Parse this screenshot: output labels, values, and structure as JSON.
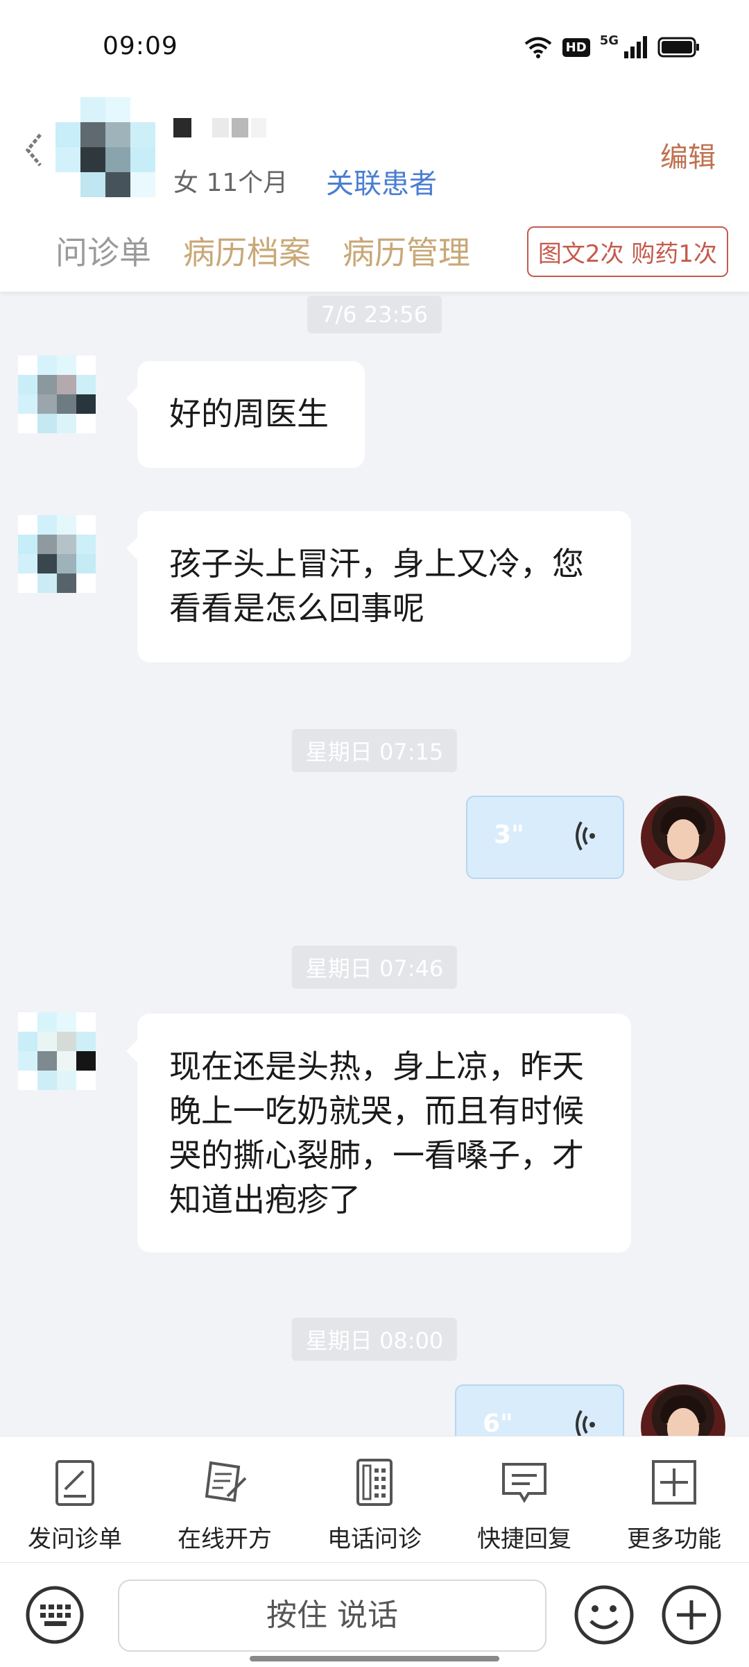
{
  "status_bar": {
    "time": "09:09",
    "hd": "HD",
    "network": "5G"
  },
  "header": {
    "patient_meta": "女 11个月",
    "link_patient_label": "关联患者",
    "edit_label": "编辑",
    "tabs": [
      {
        "label": "问诊单"
      },
      {
        "label": "病历档案"
      },
      {
        "label": "病历管理"
      }
    ],
    "quota_badge": "图文2次 购药1次"
  },
  "chat": {
    "messages": [
      {
        "type": "time",
        "text": "7/6 23:56"
      },
      {
        "type": "text_in",
        "text": "好的周医生"
      },
      {
        "type": "text_in",
        "lines": [
          "孩子头上冒汗，身上又冷，您",
          "看看是怎么回事呢"
        ]
      },
      {
        "type": "time",
        "text": "星期日 07:15"
      },
      {
        "type": "voice_out",
        "duration": "3\""
      },
      {
        "type": "time",
        "text": "星期日 07:46"
      },
      {
        "type": "text_in",
        "lines": [
          "现在还是头热，身上凉，昨天",
          "晚上一吃奶就哭，而且有时候",
          "哭的撕心裂肺，一看嗓子，才",
          "知道出疱疹了"
        ]
      },
      {
        "type": "time",
        "text": "星期日 08:00"
      },
      {
        "type": "voice_out",
        "duration": "6\""
      }
    ]
  },
  "toolbar": {
    "items": [
      {
        "label": "发问诊单",
        "icon": "form-edit-icon"
      },
      {
        "label": "在线开方",
        "icon": "prescription-icon"
      },
      {
        "label": "电话问诊",
        "icon": "phone-icon"
      },
      {
        "label": "快捷回复",
        "icon": "quick-reply-icon"
      },
      {
        "label": "更多功能",
        "icon": "more-plus-icon"
      }
    ]
  },
  "input_bar": {
    "hold_to_talk": "按住 说话"
  },
  "colors": {
    "accent_blue": "#4a7ed1",
    "edit": "#c0704f",
    "badge_red": "#c55a4c",
    "tab_warm": "#c8a877",
    "voice_bubble": "#d9ecfb"
  }
}
